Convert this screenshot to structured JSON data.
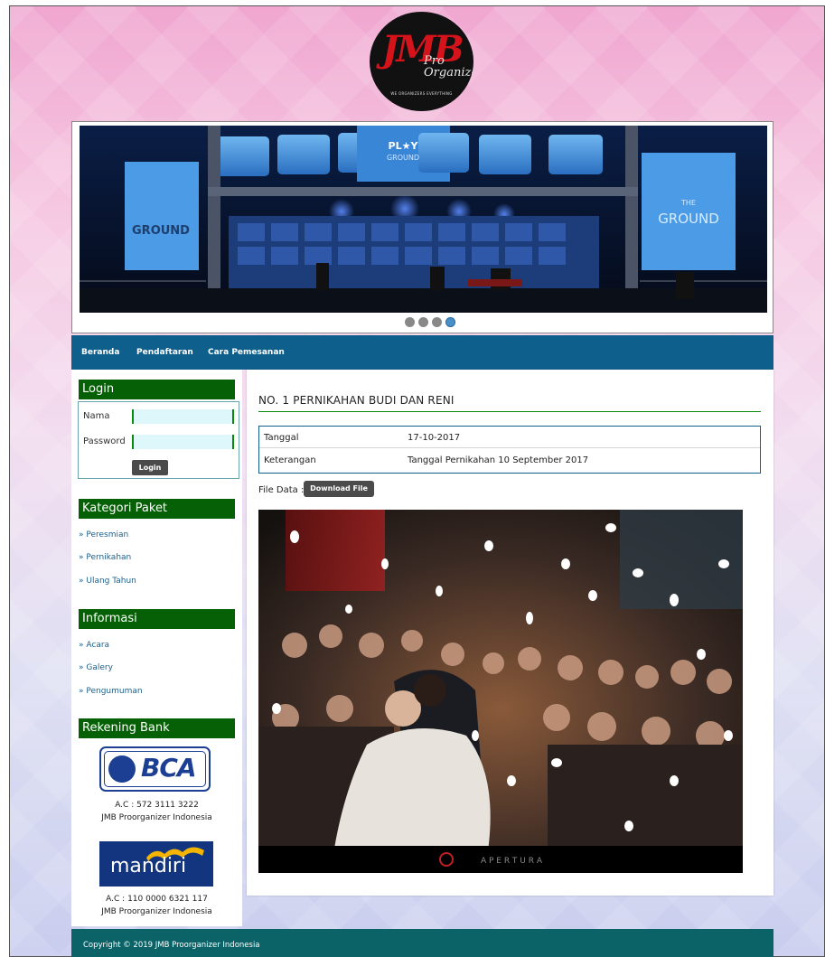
{
  "logo": {
    "brand": "JMB",
    "suffix": "Pro\nOrganizer",
    "tagline": "WE ORGANIZERS EVERYTHING"
  },
  "banner": {
    "stage_sign": "PLAY GROUND",
    "side_sign_left": "THE PLAY GROUND",
    "side_sign_right": "THE PLAY GROUND",
    "slides_total": 4,
    "active_slide": 4
  },
  "nav": {
    "items": [
      {
        "label": "Beranda"
      },
      {
        "label": "Pendaftaran"
      },
      {
        "label": "Cara Pemesanan"
      }
    ]
  },
  "sidebar": {
    "login": {
      "title": "Login",
      "name_label": "Nama",
      "password_label": "Password",
      "name_value": "",
      "password_value": "",
      "button": "Login"
    },
    "kategori": {
      "title": "Kategori Paket",
      "items": [
        "» Peresmian",
        "» Pernikahan",
        "» Ulang Tahun"
      ]
    },
    "informasi": {
      "title": "Informasi",
      "items": [
        "» Acara",
        "» Galery",
        "» Pengumuman"
      ]
    },
    "rekening": {
      "title": "Rekening Bank",
      "bca_logo": "BCA",
      "bca_account": "A.C : 572 3111 3222",
      "bca_holder": "JMB Proorganizer Indonesia",
      "mandiri_logo": "mandiri",
      "mandiri_account": "A.C : 110 0000 6321 117",
      "mandiri_holder": "JMB Proorganizer Indonesia"
    }
  },
  "content": {
    "title": "NO. 1 PERNIKAHAN BUDI DAN RENI",
    "rows": [
      {
        "key": "Tanggal",
        "value": "17-10-2017"
      },
      {
        "key": "Keterangan",
        "value": "Tanggal Pernikahan 10 September 2017"
      }
    ],
    "file_label": "File Data :",
    "download_button": "Download File",
    "photo_watermark": "A P E R T U R A"
  },
  "footer": {
    "copyright": "Copyright © 2019 JMB Proorganizer Indonesia"
  },
  "colors": {
    "nav_bg": "#0e5f8b",
    "panel_title_bg": "#066106",
    "footer_bg": "#0b6367",
    "button_bg": "#4b4b4b",
    "link": "#1a5f8c"
  }
}
